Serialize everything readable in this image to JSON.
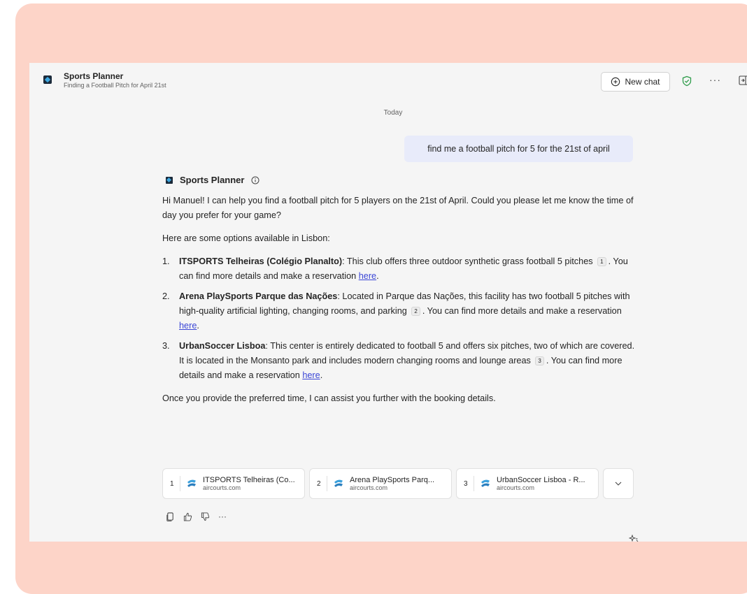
{
  "header": {
    "title": "Sports Planner",
    "subtitle": "Finding a Football Pitch for April 21st",
    "new_chat_label": "New chat",
    "more_label": "···"
  },
  "chat": {
    "date_divider": "Today",
    "user_message": "find me a football pitch for 5 for the 21st of april",
    "bot_name": "Sports Planner",
    "intro": "Hi Manuel! I can help you find a football pitch for 5 players on the 21st of April. Could you please let me know the time of day you prefer for your game?",
    "options_intro": "Here are some options available in Lisbon:",
    "options": [
      {
        "num": "1.",
        "name": "ITSPORTS Telheiras (Colégio Planalto)",
        "desc": ": This club offers three outdoor synthetic grass football 5 pitches",
        "cite": "1",
        "tail": ". You can find more details and make a reservation ",
        "link": "here",
        "end": "."
      },
      {
        "num": "2.",
        "name": "Arena PlaySports Parque das Nações",
        "desc": ": Located in Parque das Nações, this facility has two football 5 pitches with high-quality artificial lighting, changing rooms, and parking",
        "cite": "2",
        "tail": ". You can find more details and make a reservation ",
        "link": "here",
        "end": "."
      },
      {
        "num": "3.",
        "name": "UrbanSoccer Lisboa",
        "desc": ": This center is entirely dedicated to football 5 and offers six pitches, two of which are covered. It is located in the Monsanto park and includes modern changing rooms and lounge areas",
        "cite": "3",
        "tail": ". You can find more details and make a reservation ",
        "link": "here",
        "end": "."
      }
    ],
    "closing": "Once you provide the preferred time, I can assist you further with the booking details.",
    "references": [
      {
        "num": "1",
        "title": "ITSPORTS Telheiras (Co...",
        "domain": "aircourts.com"
      },
      {
        "num": "2",
        "title": "Arena PlaySports Parq...",
        "domain": "aircourts.com"
      },
      {
        "num": "3",
        "title": "UrbanSoccer Lisboa - R...",
        "domain": "aircourts.com"
      }
    ],
    "actions_more": "···"
  },
  "colors": {
    "background_frame": "#fdd4c8",
    "window": "#f5f5f5",
    "user_bubble": "#e8ebfa",
    "link": "#3b46d6",
    "shield": "#2e9c4a"
  },
  "icons": [
    "app-logo",
    "plus-circle-icon",
    "shield-check-icon",
    "more-icon",
    "side-panel-icon",
    "info-icon",
    "copy-icon",
    "thumbs-up-icon",
    "thumbs-down-icon",
    "chevron-down-icon",
    "sparkle-icon"
  ]
}
